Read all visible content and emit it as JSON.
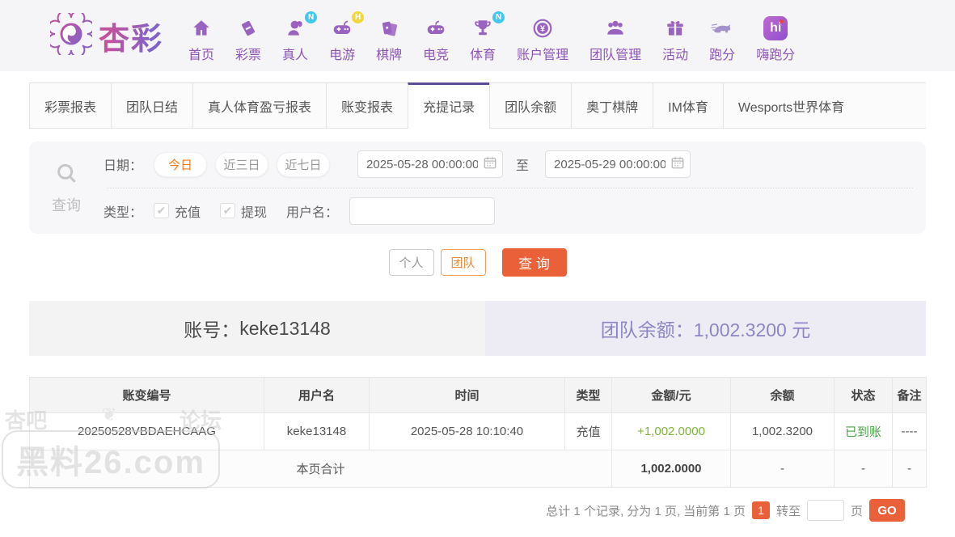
{
  "brand": {
    "name": "杏彩"
  },
  "nav": {
    "items": [
      {
        "label": "首页",
        "badge": ""
      },
      {
        "label": "彩票",
        "badge": ""
      },
      {
        "label": "真人",
        "badge": "N"
      },
      {
        "label": "电游",
        "badge": "H"
      },
      {
        "label": "棋牌",
        "badge": ""
      },
      {
        "label": "电竞",
        "badge": ""
      },
      {
        "label": "体育",
        "badge": "N"
      },
      {
        "label": "账户管理",
        "badge": ""
      },
      {
        "label": "团队管理",
        "badge": ""
      },
      {
        "label": "活动",
        "badge": ""
      },
      {
        "label": "跑分",
        "badge": ""
      },
      {
        "label": "嗨跑分",
        "badge": ""
      }
    ],
    "hi_icon_text": "hi"
  },
  "tabs": {
    "items": [
      {
        "label": "彩票报表"
      },
      {
        "label": "团队日结"
      },
      {
        "label": "真人体育盈亏报表"
      },
      {
        "label": "账变报表"
      },
      {
        "label": "充提记录"
      },
      {
        "label": "团队余额"
      },
      {
        "label": "奥丁棋牌"
      },
      {
        "label": "IM体育"
      },
      {
        "label": "Wesports世界体育"
      }
    ],
    "active_label": "充提记录"
  },
  "filter": {
    "search_label": "查询",
    "date_label": "日期：",
    "quick_ranges": [
      "今日",
      "近三日",
      "近七日"
    ],
    "active_range": "今日",
    "date_from": "2025-05-28 00:00:00",
    "to_label": "至",
    "date_to": "2025-05-29 00:00:00",
    "type_label": "类型：",
    "type_options": [
      "充值",
      "提现"
    ],
    "check_glyph": "✔",
    "username_label": "用户名：",
    "username_value": ""
  },
  "actions": {
    "personal": "个人",
    "team": "团队",
    "query": "查 询"
  },
  "account": {
    "label": "账号：",
    "value": "keke13148",
    "balance_label": "团队余额：",
    "balance_value": "1,002.3200 元"
  },
  "table": {
    "columns": [
      "账变编号",
      "用户名",
      "时间",
      "类型",
      "金额/元",
      "余额",
      "状态",
      "备注"
    ],
    "rows": [
      {
        "id": "20250528VBDAEHCAAG",
        "username": "keke13148",
        "time": "2025-05-28 10:10:40",
        "type": "充值",
        "amount": "+1,002.0000",
        "balance": "1,002.3200",
        "status": "已到账",
        "remark": "----"
      }
    ],
    "summary": {
      "label": "本页合计",
      "amount": "1,002.0000",
      "balance": "-",
      "status": "-",
      "remark": "-"
    }
  },
  "pagination": {
    "summary": "总计 1 个记录, 分为 1 页, 当前第 1 页",
    "current_page": "1",
    "goto_label": "转至",
    "page_unit": "页",
    "go_label": "GO"
  },
  "watermark": {
    "top_left": "杏吧",
    "flourish": "❦",
    "top_right": "论坛",
    "site": "黑料26.com"
  },
  "colors": {
    "brand_purple": "#8d55b8",
    "active_tab_purple": "#5c4b96",
    "primary_orange": "#ea6039",
    "amount_green": "#7fb33c",
    "status_green": "#47a447",
    "balance_purple": "#8d86c5"
  }
}
